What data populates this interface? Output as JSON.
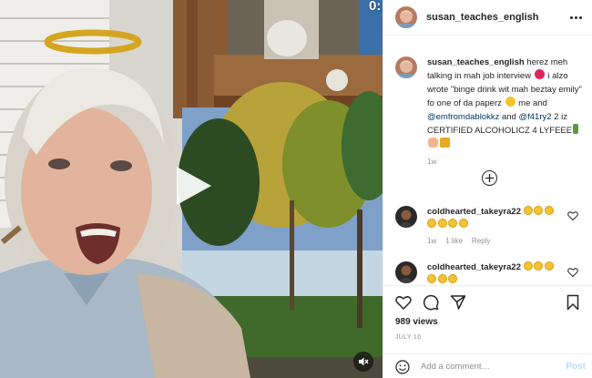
{
  "media": {
    "timecode": "0:",
    "play_icon": "play-icon",
    "mute_icon": "speaker-muted-icon"
  },
  "header": {
    "username": "susan_teaches_english",
    "more_icon": "more-options-icon"
  },
  "caption": {
    "username": "susan_teaches_english",
    "text_1": " herez meh talking in mah job interview",
    "text_2": " i alzo wrote \"binge drink wit mah beztay emily\" fo one of da paperz ",
    "text_3": " me and ",
    "mention_1": "@emfromdablokkz",
    "text_4": " and ",
    "mention_2": "@f41ry2",
    "text_5": " 2 iz CERTIFIED ALCOHOLICZ 4 LYFEEE",
    "time": "1w"
  },
  "load_more_icon": "plus-circle-icon",
  "comments": [
    {
      "username": "coldhearted_takeyra22",
      "time": "1w",
      "likes": "1 like",
      "reply": "Reply"
    },
    {
      "username": "coldhearted_takeyra22"
    }
  ],
  "actions": {
    "views": "989 views",
    "date": "JULY 16",
    "placeholder": "Add a comment…",
    "post_label": "Post"
  },
  "colors": {
    "link": "#00376b",
    "post_disabled": "#b2dffc",
    "muted_text": "#8e8e8e"
  }
}
